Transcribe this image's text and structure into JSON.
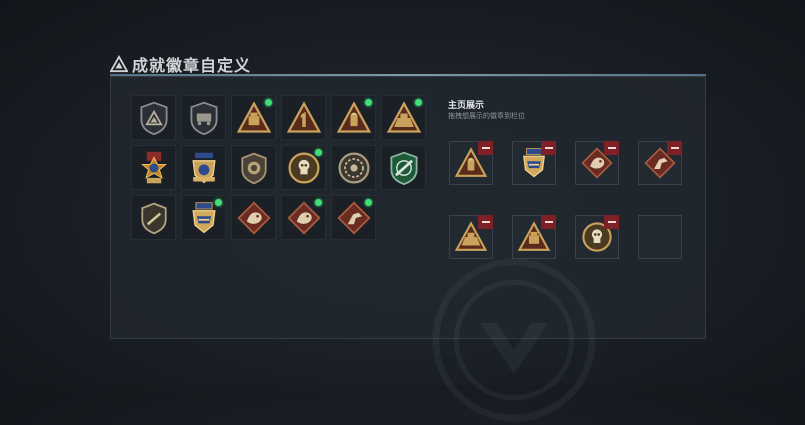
{
  "header": {
    "title": "成就徽章自定义",
    "icon": "warning-triangle-icon"
  },
  "showcase": {
    "title": "主页展示",
    "subtitle": "拖拽想展示的徽章到栏位"
  },
  "colors": {
    "accent_line": "#8fb3c8",
    "new_dot": "#3fdf7a",
    "remove": "#7e2126",
    "gold": "#c9a25c"
  },
  "badges": [
    {
      "icon": "shield-triangle-badge-icon",
      "new": false
    },
    {
      "icon": "shield-truck-badge-icon",
      "new": false
    },
    {
      "icon": "triangle-truck-badge-icon",
      "new": true
    },
    {
      "icon": "triangle-number-one-badge-icon",
      "new": false
    },
    {
      "icon": "triangle-ammo-badge-icon",
      "new": true
    },
    {
      "icon": "triangle-vehicle-badge-icon",
      "new": true
    },
    {
      "icon": "star-medal-badge-icon",
      "new": false
    },
    {
      "icon": "eagle-crest-badge-icon",
      "new": false
    },
    {
      "icon": "shield-lion-badge-icon",
      "new": false
    },
    {
      "icon": "skull-medallion-badge-icon",
      "new": true
    },
    {
      "icon": "wreath-medallion-badge-icon",
      "new": false
    },
    {
      "icon": "green-rifle-shield-badge-icon",
      "new": false
    },
    {
      "icon": "shield-dagger-badge-icon",
      "new": false
    },
    {
      "icon": "eagle-stripe-crest-badge-icon",
      "new": true
    },
    {
      "icon": "diamond-dragon-badge-icon",
      "new": false
    },
    {
      "icon": "diamond-dragon-badge-icon",
      "new": true
    },
    {
      "icon": "diamond-runner-badge-icon",
      "new": true
    }
  ],
  "slots": [
    {
      "icon": "triangle-ammo-badge-icon",
      "filled": true
    },
    {
      "icon": "eagle-stripe-crest-badge-icon",
      "filled": true
    },
    {
      "icon": "diamond-dragon-badge-icon",
      "filled": true
    },
    {
      "icon": "diamond-runner-badge-icon",
      "filled": true
    },
    {
      "icon": "triangle-vehicle-badge-icon",
      "filled": true
    },
    {
      "icon": "triangle-truck-badge-icon",
      "filled": true
    },
    {
      "icon": "skull-medallion-badge-icon",
      "filled": true
    },
    {
      "icon": "",
      "filled": false
    }
  ]
}
